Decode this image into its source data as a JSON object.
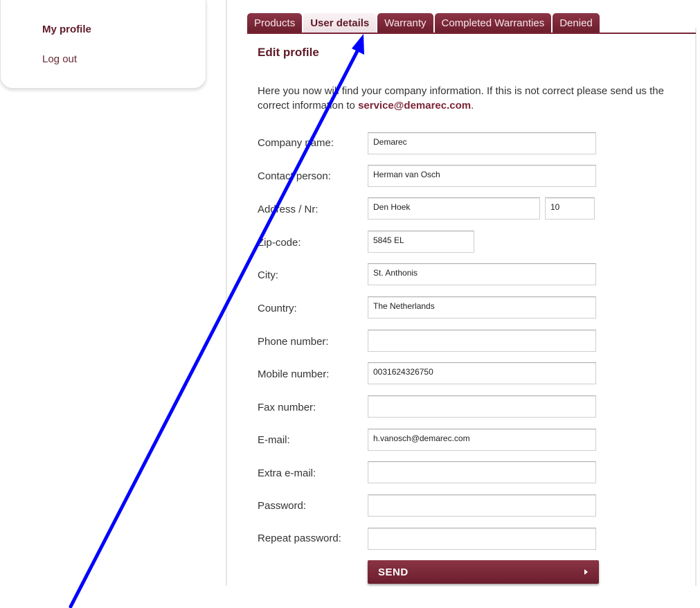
{
  "sidebar": {
    "items": [
      {
        "label": "My profile",
        "active": true
      },
      {
        "label": "Log out",
        "active": false
      }
    ]
  },
  "tabs": [
    {
      "label": "Products",
      "active": false
    },
    {
      "label": "User details",
      "active": true
    },
    {
      "label": "Warranty",
      "active": false
    },
    {
      "label": "Completed Warranties",
      "active": false
    },
    {
      "label": "Denied",
      "active": false
    }
  ],
  "main": {
    "heading": "Edit profile",
    "intro_text": "Here you now will find your company information. If this is not correct please send us the correct information to ",
    "intro_email": "service@demarec.com",
    "intro_end": "."
  },
  "form": {
    "company_name": {
      "label": "Company name:",
      "value": "Demarec"
    },
    "contact_person": {
      "label": "Contact person:",
      "value": "Herman van Osch"
    },
    "address": {
      "label": "Address / Nr:",
      "value": "Den Hoek",
      "number": "10"
    },
    "zip_code": {
      "label": "Zip-code:",
      "value": "5845 EL"
    },
    "city": {
      "label": "City:",
      "value": "St. Anthonis"
    },
    "country": {
      "label": "Country:",
      "value": "The Netherlands"
    },
    "phone": {
      "label": "Phone number:",
      "value": ""
    },
    "mobile": {
      "label": "Mobile number:",
      "value": "0031624326750"
    },
    "fax": {
      "label": "Fax number:",
      "value": ""
    },
    "email": {
      "label": "E-mail:",
      "value": "h.vanosch@demarec.com"
    },
    "extra_email": {
      "label": "Extra e-mail:",
      "value": ""
    },
    "password": {
      "label": "Password:",
      "value": ""
    },
    "repeat_password": {
      "label": "Repeat password:",
      "value": ""
    },
    "send_label": "SEND"
  },
  "colors": {
    "brand": "#7b2537",
    "annotation_arrow": "#0000ff"
  },
  "icons": {
    "send_arrow": "triangle-right-icon",
    "annotation": "arrow-annotation"
  }
}
